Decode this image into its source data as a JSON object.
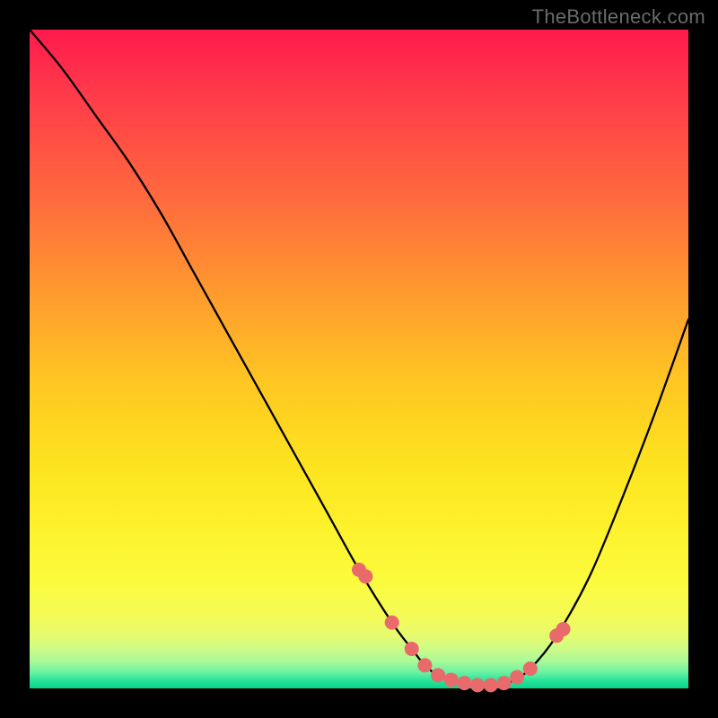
{
  "watermark": "TheBottleneck.com",
  "colors": {
    "frame": "#000000",
    "curve": "#000000",
    "dot": "#e86a6a",
    "gradient_top": "#ff1a4d",
    "gradient_mid": "#fde31f",
    "gradient_bottom": "#06d68c"
  },
  "chart_data": {
    "type": "line",
    "title": "",
    "xlabel": "",
    "ylabel": "",
    "xlim": [
      0,
      100
    ],
    "ylim": [
      0,
      100
    ],
    "series": [
      {
        "name": "bottleneck-curve",
        "x": [
          0,
          5,
          10,
          15,
          20,
          25,
          30,
          35,
          40,
          45,
          50,
          55,
          58,
          60,
          62,
          65,
          68,
          70,
          73,
          76,
          80,
          85,
          90,
          95,
          100
        ],
        "y": [
          100,
          94,
          87,
          80,
          72,
          63,
          54,
          45,
          36,
          27,
          18,
          10,
          6,
          3.5,
          2,
          1,
          0.5,
          0.5,
          1,
          3,
          8,
          17,
          29,
          42,
          56
        ]
      }
    ],
    "markers": {
      "name": "highlight-points",
      "x": [
        50,
        51,
        55,
        58,
        60,
        62,
        64,
        66,
        68,
        70,
        72,
        74,
        76,
        80,
        81
      ],
      "y": [
        18,
        17,
        10,
        6,
        3.5,
        2,
        1.3,
        0.8,
        0.5,
        0.5,
        0.8,
        1.7,
        3,
        8,
        9
      ]
    }
  }
}
